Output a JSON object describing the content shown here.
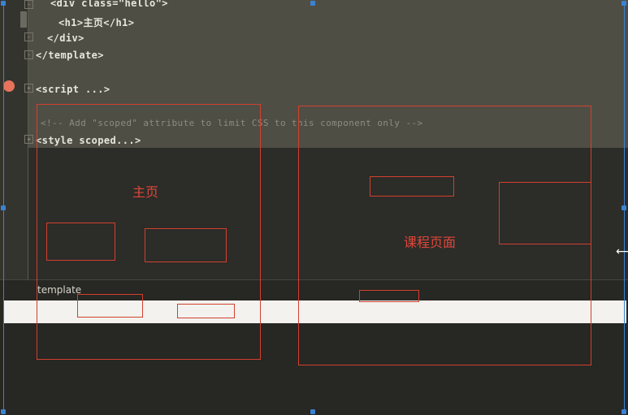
{
  "editor": {
    "lines": [
      {
        "text": "<div class=\"hello\">"
      },
      {
        "text": "<h1>主页</h1>"
      },
      {
        "text": "</div>"
      },
      {
        "text": "</template>"
      },
      {
        "text": "<script ...>"
      },
      {
        "text": "<!-- Add \"scoped\" attribute to limit CSS to this component only -->"
      },
      {
        "text": "<style scoped...>"
      }
    ]
  },
  "panel": {
    "title": "template"
  },
  "wireframe": {
    "home_label": "主页",
    "course_label": "课程页面"
  },
  "colors": {
    "wireframe_stroke": "#d2402f",
    "selection_handle": "#3b82d4",
    "breakpoint": "#e8735a"
  }
}
